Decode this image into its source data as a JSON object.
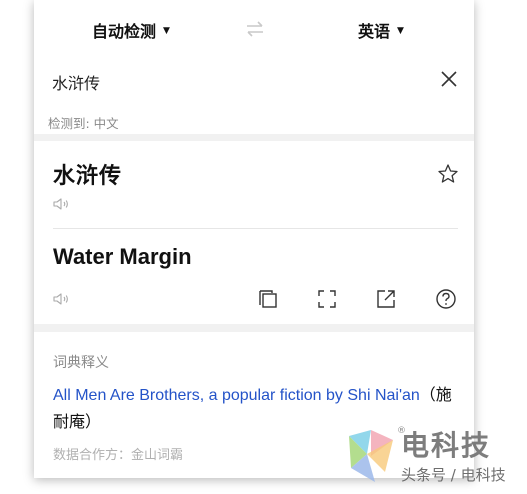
{
  "header": {
    "source_lang": "自动检测",
    "target_lang": "英语"
  },
  "input": {
    "text": "水浒传",
    "detected_label": "检测到: 中文"
  },
  "result": {
    "source_word": "水浒传",
    "translation": "Water Margin"
  },
  "dictionary": {
    "title": "词典释义",
    "definition_en": "All Men Are Brothers, a popular fiction by Shi Nai'an",
    "definition_cn": "（施耐庵）",
    "source_note": "数据合作方：金山词霸"
  },
  "watermark": {
    "brand": "电科技",
    "sub": "头条号 / 电科技"
  },
  "icons": [
    "chevron-down-icon",
    "swap-icon",
    "close-icon",
    "star-icon",
    "speaker-icon",
    "copy-icon",
    "fullscreen-icon",
    "share-icon",
    "help-icon"
  ]
}
